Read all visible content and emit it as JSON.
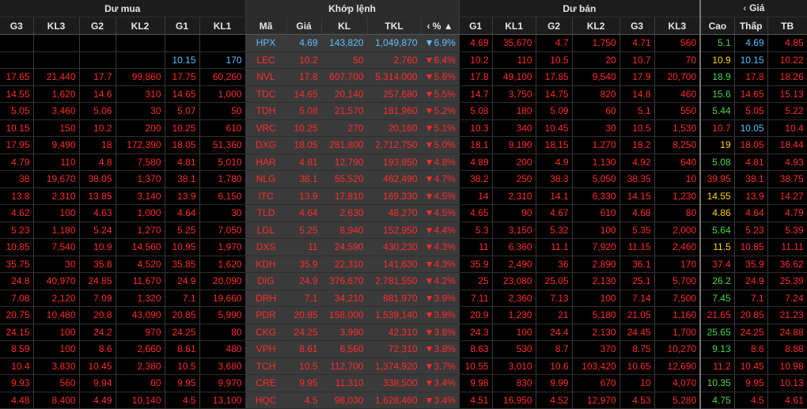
{
  "groups": {
    "du_mua": "Dư mua",
    "khop_lenh": "Khớp lệnh",
    "du_ban": "Dư bán",
    "gia": "Giá",
    "gia_chevron": "‹"
  },
  "columns": {
    "buy": [
      "G3",
      "KL3",
      "G2",
      "KL2",
      "G1",
      "KL1"
    ],
    "match": [
      "Mã",
      "Giá",
      "KL",
      "TKL",
      "%"
    ],
    "pct_sort": "‹ % ▲",
    "sell": [
      "G1",
      "KL1",
      "G2",
      "KL2",
      "G3",
      "KL3"
    ],
    "price": [
      "Cao",
      "Thấp",
      "TB"
    ]
  },
  "rows": [
    {
      "code": "HPX",
      "buy": [
        "",
        "",
        "",
        "",
        "",
        ""
      ],
      "match": [
        "4.69",
        "143,820",
        "1,049,870",
        "▼6.9%"
      ],
      "sell": [
        "4.69",
        "35,670",
        "4.7",
        "1,750",
        "4.71",
        "560"
      ],
      "high": "5.1",
      "low": "4.69",
      "avg": "4.85",
      "tone": "blue",
      "htone": "green",
      "ltone": "blue"
    },
    {
      "code": "LEC",
      "buy": [
        "",
        "",
        "",
        "",
        "10.15",
        "170"
      ],
      "match": [
        "10.2",
        "50",
        "2,760",
        "▼6.4%"
      ],
      "sell": [
        "10.2",
        "110",
        "10.5",
        "20",
        "10.7",
        "70"
      ],
      "high": "10.9",
      "low": "10.15",
      "avg": "10.22",
      "tone": "red",
      "htone": "yellow",
      "ltone": "blue",
      "buyblue": true
    },
    {
      "code": "NVL",
      "buy": [
        "17.65",
        "21,440",
        "17.7",
        "99,860",
        "17.75",
        "60,260"
      ],
      "match": [
        "17.8",
        "607,700",
        "5,314,000",
        "▼5.6%"
      ],
      "sell": [
        "17.8",
        "49,100",
        "17.85",
        "9,540",
        "17.9",
        "20,700"
      ],
      "high": "18.9",
      "low": "17.8",
      "avg": "18.26",
      "tone": "red",
      "htone": "green",
      "ltone": "red"
    },
    {
      "code": "TDC",
      "buy": [
        "14.55",
        "1,620",
        "14.6",
        "310",
        "14.65",
        "1,000"
      ],
      "match": [
        "14.65",
        "20,140",
        "257,680",
        "▼5.5%"
      ],
      "sell": [
        "14.7",
        "3,750",
        "14.75",
        "820",
        "14.8",
        "460"
      ],
      "high": "15.6",
      "low": "14.65",
      "avg": "15.13",
      "tone": "red",
      "htone": "green",
      "ltone": "red"
    },
    {
      "code": "TDH",
      "buy": [
        "5.05",
        "3,460",
        "5.06",
        "30",
        "5.07",
        "50"
      ],
      "match": [
        "5.08",
        "21,570",
        "181,960",
        "▼5.2%"
      ],
      "sell": [
        "5.08",
        "180",
        "5.09",
        "60",
        "5.1",
        "550"
      ],
      "high": "5.44",
      "low": "5.05",
      "avg": "5.22",
      "tone": "red",
      "htone": "green",
      "ltone": "red"
    },
    {
      "code": "VRC",
      "buy": [
        "10.15",
        "150",
        "10.2",
        "200",
        "10.25",
        "610"
      ],
      "match": [
        "10.25",
        "270",
        "20,160",
        "▼5.1%"
      ],
      "sell": [
        "10.3",
        "340",
        "10.45",
        "30",
        "10.5",
        "1,530"
      ],
      "high": "10.7",
      "low": "10.05",
      "avg": "10.4",
      "tone": "red",
      "htone": "red",
      "ltone": "blue"
    },
    {
      "code": "DXG",
      "buy": [
        "17.95",
        "9,490",
        "18",
        "172,390",
        "18.05",
        "51,360"
      ],
      "match": [
        "18.05",
        "281,800",
        "2,712,750",
        "▼5.0%"
      ],
      "sell": [
        "18.1",
        "9,190",
        "18.15",
        "1,270",
        "18.2",
        "8,250"
      ],
      "high": "19",
      "low": "18.05",
      "avg": "18.44",
      "tone": "red",
      "htone": "yellow",
      "ltone": "red"
    },
    {
      "code": "HAR",
      "buy": [
        "4.79",
        "110",
        "4.8",
        "7,580",
        "4.81",
        "5,010"
      ],
      "match": [
        "4.81",
        "12,790",
        "193,850",
        "▼4.8%"
      ],
      "sell": [
        "4.89",
        "200",
        "4.9",
        "1,130",
        "4.92",
        "640"
      ],
      "high": "5.08",
      "low": "4.81",
      "avg": "4.93",
      "tone": "red",
      "htone": "green",
      "ltone": "red"
    },
    {
      "code": "NLG",
      "buy": [
        "38",
        "19,670",
        "38.05",
        "1,370",
        "38.1",
        "1,780"
      ],
      "match": [
        "38.1",
        "55,520",
        "462,490",
        "▼4.7%"
      ],
      "sell": [
        "38.2",
        "250",
        "38.3",
        "5,050",
        "38.35",
        "10"
      ],
      "high": "39.95",
      "low": "38.1",
      "avg": "38.75",
      "tone": "red",
      "htone": "red",
      "ltone": "red"
    },
    {
      "code": "ITC",
      "buy": [
        "13.8",
        "2,310",
        "13.85",
        "3,140",
        "13.9",
        "6,150"
      ],
      "match": [
        "13.9",
        "17,810",
        "169,330",
        "▼4.5%"
      ],
      "sell": [
        "14",
        "2,310",
        "14.1",
        "6,330",
        "14.15",
        "1,230"
      ],
      "high": "14.55",
      "low": "13.9",
      "avg": "14.27",
      "tone": "red",
      "htone": "yellow",
      "ltone": "red"
    },
    {
      "code": "TLD",
      "buy": [
        "4.62",
        "100",
        "4.63",
        "1,000",
        "4.64",
        "30"
      ],
      "match": [
        "4.64",
        "2,630",
        "48,270",
        "▼4.5%"
      ],
      "sell": [
        "4.65",
        "90",
        "4.67",
        "610",
        "4.68",
        "80"
      ],
      "high": "4.86",
      "low": "4.64",
      "avg": "4.79",
      "tone": "red",
      "htone": "yellow",
      "ltone": "red"
    },
    {
      "code": "LGL",
      "buy": [
        "5.23",
        "1,180",
        "5.24",
        "1,270",
        "5.25",
        "7,050"
      ],
      "match": [
        "5.25",
        "8,940",
        "152,950",
        "▼4.4%"
      ],
      "sell": [
        "5.3",
        "3,150",
        "5.32",
        "100",
        "5.35",
        "2,000"
      ],
      "high": "5.64",
      "low": "5.23",
      "avg": "5.39",
      "tone": "red",
      "htone": "green",
      "ltone": "red"
    },
    {
      "code": "DXS",
      "buy": [
        "10.85",
        "7,540",
        "10.9",
        "14,560",
        "10.95",
        "1,970"
      ],
      "match": [
        "11",
        "24,590",
        "430,230",
        "▼4.3%"
      ],
      "sell": [
        "11",
        "6,360",
        "11.1",
        "7,920",
        "11.15",
        "2,460"
      ],
      "high": "11.5",
      "low": "10.85",
      "avg": "11.11",
      "tone": "red",
      "htone": "yellow",
      "ltone": "red"
    },
    {
      "code": "KDH",
      "buy": [
        "35.75",
        "30",
        "35.8",
        "4,520",
        "35.85",
        "1,620"
      ],
      "match": [
        "35.9",
        "22,310",
        "141,630",
        "▼4.3%"
      ],
      "sell": [
        "35.9",
        "2,490",
        "36",
        "2,890",
        "36.1",
        "170"
      ],
      "high": "37.4",
      "low": "35.9",
      "avg": "36.62",
      "tone": "red",
      "htone": "red",
      "ltone": "red"
    },
    {
      "code": "DIG",
      "buy": [
        "24.8",
        "40,970",
        "24.85",
        "11,670",
        "24.9",
        "20,090"
      ],
      "match": [
        "24.9",
        "376,670",
        "2,781,550",
        "▼4.2%"
      ],
      "sell": [
        "25",
        "23,080",
        "25.05",
        "2,130",
        "25.1",
        "5,700"
      ],
      "high": "26.2",
      "low": "24.9",
      "avg": "25.39",
      "tone": "red",
      "htone": "green",
      "ltone": "red"
    },
    {
      "code": "DRH",
      "buy": [
        "7.08",
        "2,120",
        "7.09",
        "1,320",
        "7.1",
        "19,660"
      ],
      "match": [
        "7.1",
        "34,210",
        "881,970",
        "▼3.9%"
      ],
      "sell": [
        "7.11",
        "2,360",
        "7.13",
        "100",
        "7.14",
        "7,500"
      ],
      "high": "7.45",
      "low": "7.1",
      "avg": "7.24",
      "tone": "red",
      "htone": "green",
      "ltone": "red"
    },
    {
      "code": "PDR",
      "buy": [
        "20.75",
        "10,480",
        "20.8",
        "43,090",
        "20.85",
        "5,990"
      ],
      "match": [
        "20.85",
        "158,000",
        "1,539,140",
        "▼3.9%"
      ],
      "sell": [
        "20.9",
        "1,230",
        "21",
        "5,180",
        "21.05",
        "1,160"
      ],
      "high": "21.65",
      "low": "20.85",
      "avg": "21.23",
      "tone": "red",
      "htone": "red",
      "ltone": "red"
    },
    {
      "code": "CKG",
      "buy": [
        "24.15",
        "100",
        "24.2",
        "970",
        "24.25",
        "80"
      ],
      "match": [
        "24.25",
        "3,990",
        "42,310",
        "▼3.8%"
      ],
      "sell": [
        "24.3",
        "100",
        "24.4",
        "2,130",
        "24.45",
        "1,700"
      ],
      "high": "25.65",
      "low": "24.25",
      "avg": "24.88",
      "tone": "red",
      "htone": "green",
      "ltone": "red"
    },
    {
      "code": "VPH",
      "buy": [
        "8.59",
        "100",
        "8.6",
        "2,660",
        "8.61",
        "480"
      ],
      "match": [
        "8.61",
        "6,560",
        "72,310",
        "▼3.8%"
      ],
      "sell": [
        "8.63",
        "530",
        "8.7",
        "370",
        "8.75",
        "10,270"
      ],
      "high": "9.13",
      "low": "8.6",
      "avg": "8.88",
      "tone": "red",
      "htone": "green",
      "ltone": "red"
    },
    {
      "code": "TCH",
      "buy": [
        "10.4",
        "3,830",
        "10.45",
        "2,380",
        "10.5",
        "3,680"
      ],
      "match": [
        "10.5",
        "112,700",
        "1,374,920",
        "▼3.7%"
      ],
      "sell": [
        "10.55",
        "3,010",
        "10.6",
        "103,420",
        "10.65",
        "12,690"
      ],
      "high": "11.2",
      "low": "10.45",
      "avg": "10.98",
      "tone": "red",
      "htone": "red",
      "ltone": "red"
    },
    {
      "code": "CRE",
      "buy": [
        "9.93",
        "560",
        "9.94",
        "60",
        "9.95",
        "9,970"
      ],
      "match": [
        "9.95",
        "11,310",
        "338,500",
        "▼3.4%"
      ],
      "sell": [
        "9.98",
        "830",
        "9.99",
        "670",
        "10",
        "4,070"
      ],
      "high": "10.35",
      "low": "9.95",
      "avg": "10.13",
      "tone": "red",
      "htone": "green",
      "ltone": "red"
    },
    {
      "code": "HQC",
      "buy": [
        "4.48",
        "8,400",
        "4.49",
        "10,140",
        "4.5",
        "13,100"
      ],
      "match": [
        "4.5",
        "98,030",
        "1,628,460",
        "▼3.4%"
      ],
      "sell": [
        "4.51",
        "16,950",
        "4.52",
        "12,970",
        "4.53",
        "5,280"
      ],
      "high": "4.75",
      "low": "4.5",
      "avg": "4.61",
      "tone": "red",
      "htone": "green",
      "ltone": "red"
    }
  ],
  "colors": {
    "red": "#ff2b2b",
    "blue": "#5bc0ff",
    "yellow": "#ffd400",
    "green": "#4cd64c",
    "match_bg": "#3a3a3a"
  }
}
